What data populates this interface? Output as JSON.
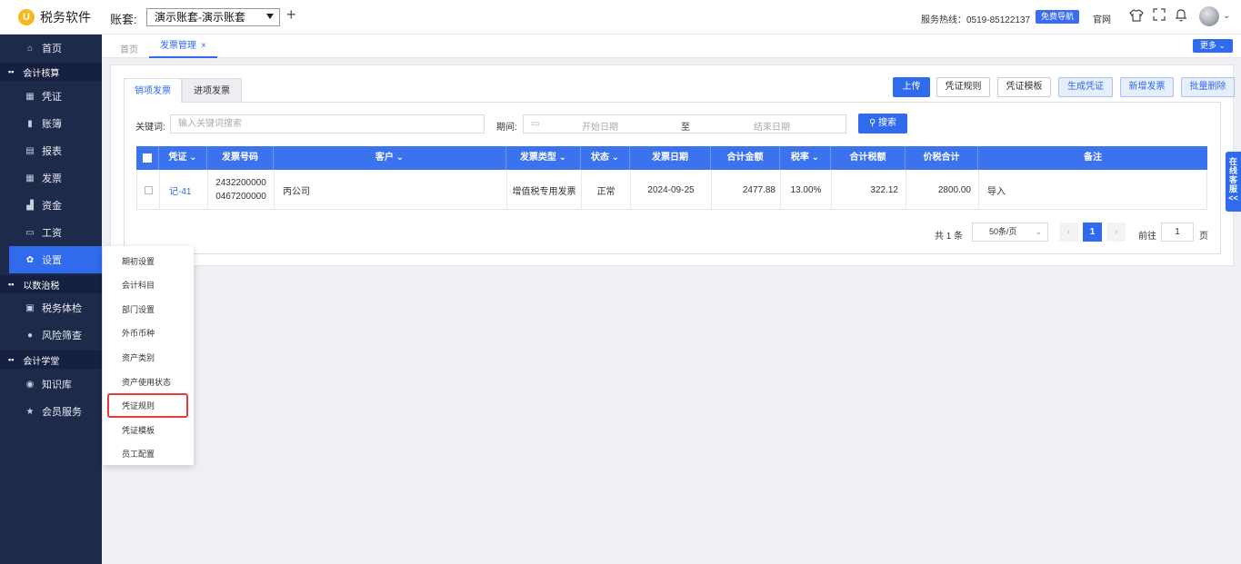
{
  "app": {
    "title": "税务软件",
    "logo_glyph": "U"
  },
  "header": {
    "account_label": "账套:",
    "account_value": "演示账套-演示账套",
    "hotline": "服务热线：0519-85122137",
    "free_guide": "免费导航",
    "official_site": "官网"
  },
  "sidebar": {
    "items": [
      {
        "label": "首页",
        "icon": "home-icon",
        "glyph": "⌂"
      },
      {
        "label": "凭证",
        "icon": "voucher-icon",
        "glyph": "▦"
      },
      {
        "label": "账簿",
        "icon": "ledger-icon",
        "glyph": "▮"
      },
      {
        "label": "报表",
        "icon": "report-icon",
        "glyph": "▤"
      },
      {
        "label": "发票",
        "icon": "invoice-icon",
        "glyph": "▦"
      },
      {
        "label": "资金",
        "icon": "fund-icon",
        "glyph": "▟"
      },
      {
        "label": "工资",
        "icon": "salary-icon",
        "glyph": "▭"
      },
      {
        "label": "设置",
        "icon": "gear-icon",
        "glyph": "✿"
      },
      {
        "label": "税务体检",
        "icon": "checkup-icon",
        "glyph": "▣"
      },
      {
        "label": "风险筛查",
        "icon": "risk-icon",
        "glyph": "●"
      },
      {
        "label": "知识库",
        "icon": "location-icon",
        "glyph": "◉"
      },
      {
        "label": "会员服务",
        "icon": "star-icon",
        "glyph": "★"
      }
    ],
    "groups": [
      "会计核算",
      "以数治税",
      "会计学堂"
    ]
  },
  "tabs": {
    "home": "首页",
    "invoice_mgmt": "发票管理",
    "close": "×",
    "more": "更多 ⌄"
  },
  "subtabs": {
    "sales": "销项发票",
    "purchase": "进项发票"
  },
  "toolbar": {
    "upload": "上传",
    "voucher_rule": "凭证规则",
    "voucher_template": "凭证模板",
    "generate_voucher": "生成凭证",
    "add_invoice": "新增发票",
    "batch_delete": "批量删除"
  },
  "filter": {
    "keyword_label": "关键词:",
    "keyword_placeholder": "输入关键词搜索",
    "period_label": "期间:",
    "start_placeholder": "开始日期",
    "to": "至",
    "end_placeholder": "结束日期",
    "search": "搜索"
  },
  "table": {
    "headers": [
      "凭证",
      "发票号码",
      "客户",
      "发票类型",
      "状态",
      "发票日期",
      "合计金额",
      "税率",
      "合计税额",
      "价税合计",
      "备注"
    ],
    "rows": [
      {
        "voucher": "记-41",
        "invoice_no_1": "2432200000",
        "invoice_no_2": "0467200000",
        "customer": "丙公司",
        "type": "增值税专用发票",
        "status": "正常",
        "date": "2024-09-25",
        "amount": "2477.88",
        "tax_rate": "13.00%",
        "tax": "322.12",
        "total": "2800.00",
        "remark": "导入"
      }
    ]
  },
  "pagination": {
    "total": "共 1 条",
    "page_size": "50条/页",
    "current": "1",
    "goto_label": "前往",
    "goto_value": "1",
    "page_unit": "页"
  },
  "online_service": "在线客服<<",
  "settings_menu": [
    "期初设置",
    "会计科目",
    "部门设置",
    "外币币种",
    "资产类别",
    "资产使用状态",
    "凭证规则",
    "凭证模板",
    "员工配置"
  ],
  "colors": {
    "primary": "#2f6bec",
    "sidebar": "#1e2a4a",
    "highlight": "#e53a3a"
  }
}
